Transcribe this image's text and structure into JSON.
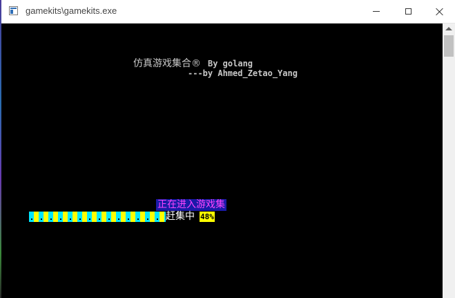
{
  "window": {
    "title": "gamekits\\gamekits.exe",
    "icon": "console-window-icon"
  },
  "console": {
    "background": "#000000",
    "banner_title": "仿真游戏集合®",
    "banner_by": "By golang",
    "author_line": "---by Ahmed_Zetao_Yang",
    "loading_label": "正在进入游戏集",
    "progress_tail_text": "赶集中",
    "progress_percent_text": "48%",
    "progress_value": 0.48
  },
  "colors": {
    "progress_cyan": "#00e5ff",
    "progress_yellow": "#ffff00",
    "label_bg": "#1a1aa8",
    "label_fg": "#ff44ff"
  }
}
